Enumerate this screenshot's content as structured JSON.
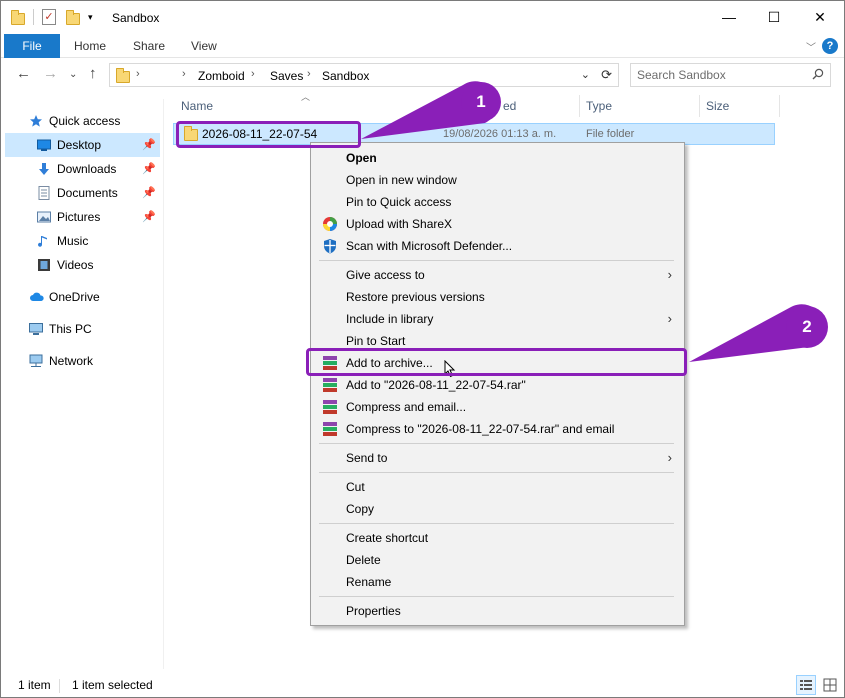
{
  "window": {
    "title": "Sandbox",
    "controls": {
      "minimize": "—",
      "maximize": "☐",
      "close": "✕"
    }
  },
  "ribbon": {
    "tabs": [
      "File",
      "Home",
      "Share",
      "View"
    ],
    "help": "?"
  },
  "address": {
    "crumbs": [
      "Zomboid",
      "Saves",
      "Sandbox"
    ],
    "search_placeholder": "Search Sandbox"
  },
  "sidebar": {
    "items": [
      {
        "label": "Quick access",
        "icon": "star-icon",
        "pinned": false
      },
      {
        "label": "Desktop",
        "icon": "desktop-icon",
        "pinned": true,
        "selected": true
      },
      {
        "label": "Downloads",
        "icon": "download-icon",
        "pinned": true
      },
      {
        "label": "Documents",
        "icon": "document-icon",
        "pinned": true
      },
      {
        "label": "Pictures",
        "icon": "pictures-icon",
        "pinned": true
      },
      {
        "label": "Music",
        "icon": "music-icon",
        "pinned": false
      },
      {
        "label": "Videos",
        "icon": "video-icon",
        "pinned": false
      },
      {
        "label": "OneDrive",
        "icon": "cloud-icon",
        "pinned": false
      },
      {
        "label": "This PC",
        "icon": "computer-icon",
        "pinned": false
      },
      {
        "label": "Network",
        "icon": "network-icon",
        "pinned": false
      }
    ]
  },
  "file_list": {
    "columns": [
      "Name",
      "ed",
      "Type",
      "Size"
    ],
    "rows": [
      {
        "name": "2026-08-11_22-07-54",
        "date": "19/08/2026 01:13 a. m.",
        "type": "File folder",
        "size": ""
      }
    ]
  },
  "context_menu": {
    "items": [
      {
        "label": "Open",
        "bold": true
      },
      {
        "label": "Open in new window"
      },
      {
        "label": "Pin to Quick access"
      },
      {
        "label": "Upload with ShareX",
        "icon": "sharex-icon"
      },
      {
        "label": "Scan with Microsoft Defender...",
        "icon": "defender-icon"
      },
      {
        "label": "Give access to",
        "submenu": true
      },
      {
        "label": "Restore previous versions"
      },
      {
        "label": "Include in library",
        "submenu": true
      },
      {
        "label": "Pin to Start"
      },
      {
        "label": "Add to archive...",
        "icon": "winrar-icon"
      },
      {
        "label": "Add to \"2026-08-11_22-07-54.rar\"",
        "icon": "winrar-icon"
      },
      {
        "label": "Compress and email...",
        "icon": "winrar-icon"
      },
      {
        "label": "Compress to \"2026-08-11_22-07-54.rar\" and email",
        "icon": "winrar-icon"
      },
      {
        "label": "Send to",
        "submenu": true
      },
      {
        "label": "Cut"
      },
      {
        "label": "Copy"
      },
      {
        "label": "Create shortcut"
      },
      {
        "label": "Delete"
      },
      {
        "label": "Rename"
      },
      {
        "label": "Properties"
      }
    ]
  },
  "status": {
    "count": "1 item",
    "selection": "1 item selected"
  },
  "annotations": [
    {
      "number": "1"
    },
    {
      "number": "2"
    }
  ],
  "colors": {
    "accent": "#1979ca",
    "selection": "#cce8ff",
    "annotation": "#8a1fb8"
  }
}
